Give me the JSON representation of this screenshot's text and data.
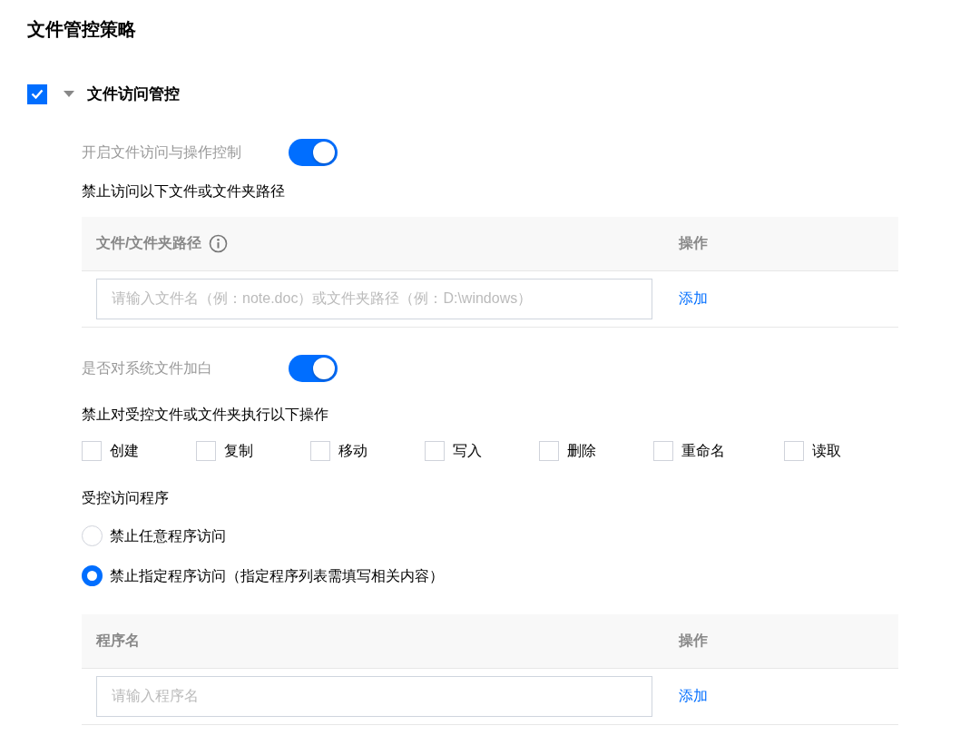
{
  "page_title": "文件管控策略",
  "section": {
    "label": "文件访问管控",
    "checked": true,
    "expanded": true,
    "enable_control": {
      "label": "开启文件访问与操作控制",
      "on": true
    },
    "path_list": {
      "title": "禁止访问以下文件或文件夹路径",
      "columns": [
        {
          "label": "文件/文件夹路径",
          "info": true
        },
        {
          "label": "操作",
          "info": false
        }
      ],
      "input": {
        "placeholder": "请输入文件名（例：note.doc）或文件夹路径（例：D:\\windows）"
      },
      "action": "添加"
    },
    "system_whitelist": {
      "label": "是否对系统文件加白",
      "on": true
    },
    "operations": {
      "title": "禁止对受控文件或文件夹执行以下操作",
      "options": [
        {
          "label": "创建",
          "checked": false
        },
        {
          "label": "复制",
          "checked": false
        },
        {
          "label": "移动",
          "checked": false
        },
        {
          "label": "写入",
          "checked": false
        },
        {
          "label": "删除",
          "checked": false
        },
        {
          "label": "重命名",
          "checked": false
        },
        {
          "label": "读取",
          "checked": false
        }
      ]
    },
    "program_access": {
      "title": "受控访问程序",
      "options": [
        {
          "label": "禁止任意程序访问",
          "selected": false
        },
        {
          "label": "禁止指定程序访问（指定程序列表需填写相关内容）",
          "selected": true
        }
      ]
    },
    "program_list": {
      "columns": [
        {
          "label": "程序名",
          "info": false
        },
        {
          "label": "操作",
          "info": false
        }
      ],
      "input": {
        "placeholder": "请输入程序名"
      },
      "action": "添加"
    }
  }
}
